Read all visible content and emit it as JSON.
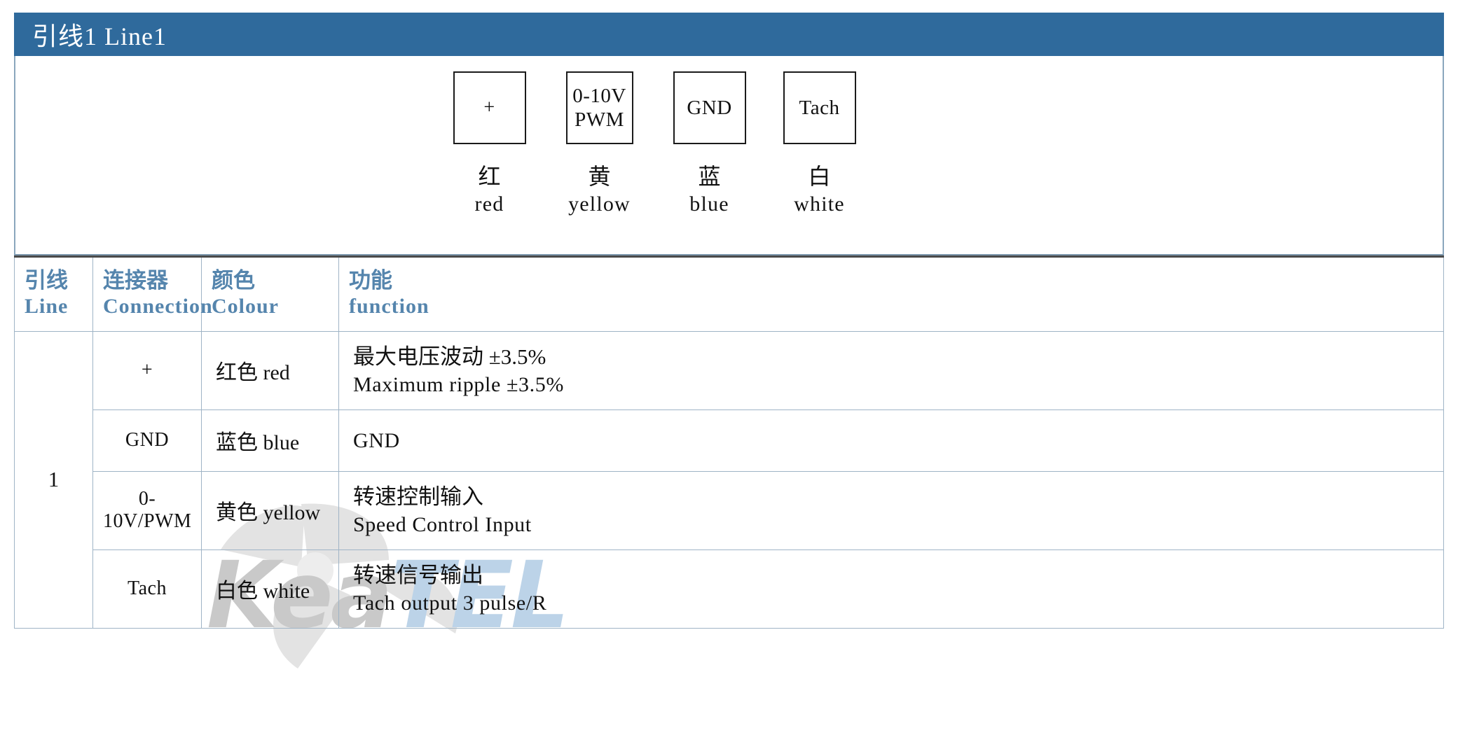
{
  "header": {
    "title": "引线1 Line1",
    "bar_color": "#2f6a9c",
    "text_color": "#ffffff"
  },
  "watermark": {
    "text_primary": "Kea",
    "text_secondary": "TEL",
    "primary_color": "#c9c9c9",
    "secondary_color": "#bcd3e8"
  },
  "diagram": {
    "connectors": [
      {
        "box_line1": "+",
        "box_line2": "",
        "label_cn": "红",
        "label_en": "red"
      },
      {
        "box_line1": "0-10V",
        "box_line2": "PWM",
        "label_cn": "黄",
        "label_en": "yellow"
      },
      {
        "box_line1": "GND",
        "box_line2": "",
        "label_cn": "蓝",
        "label_en": "blue"
      },
      {
        "box_line1": "Tach",
        "box_line2": "",
        "label_cn": "白",
        "label_en": "white"
      }
    ]
  },
  "table": {
    "header_text_color": "#5585ad",
    "columns": [
      {
        "cn": "引线",
        "en": "Line"
      },
      {
        "cn": "连接器",
        "en": "Connection"
      },
      {
        "cn": "颜色",
        "en": "Colour"
      },
      {
        "cn": "功能",
        "en": "function"
      }
    ],
    "line_number": "1",
    "rows": [
      {
        "connection": "+",
        "colour": "红色 red",
        "function_cn": "最大电压波动 ±3.5%",
        "function_en": "Maximum ripple ±3.5%"
      },
      {
        "connection": "GND",
        "colour": "蓝色 blue",
        "function_cn": "",
        "function_en": "GND"
      },
      {
        "connection": "0-10V/PWM",
        "colour": "黄色 yellow",
        "function_cn": "转速控制输入",
        "function_en": "Speed Control Input"
      },
      {
        "connection": "Tach",
        "colour": "白色 white",
        "function_cn": "转速信号输出",
        "function_en": "Tach output 3 pulse/R"
      }
    ]
  }
}
